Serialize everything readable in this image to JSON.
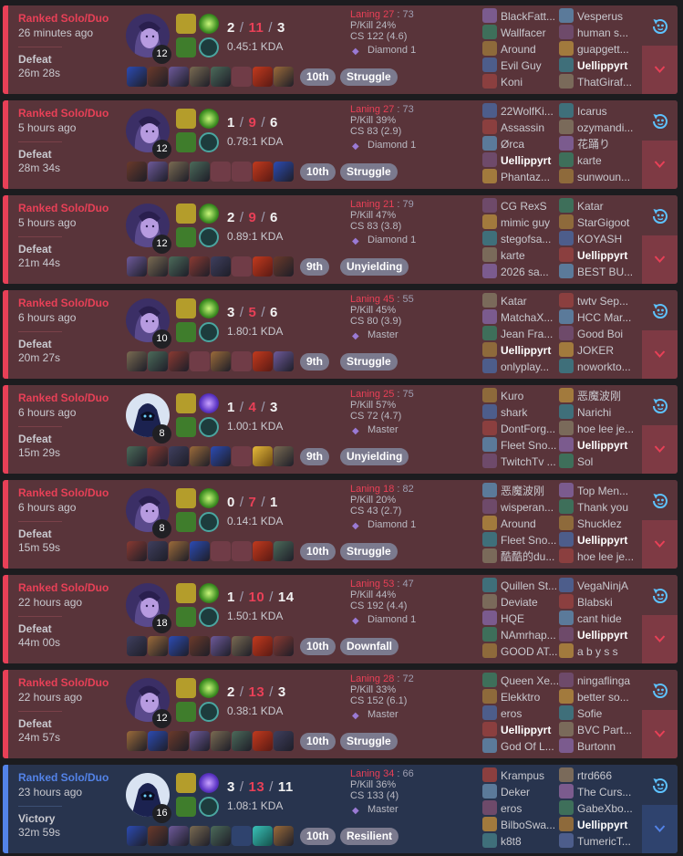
{
  "colors": {
    "loss": "#e84057",
    "win": "#5383e8",
    "badge": "#7b7a8e",
    "tier": "#9a7ad4"
  },
  "matches": [
    {
      "result_type": "loss",
      "queue": "Ranked Solo/Duo",
      "ago": "26 minutes ago",
      "result": "Defeat",
      "duration": "26m 28s",
      "champion_level": "12",
      "kills": "2",
      "deaths": "11",
      "assists": "3",
      "kda_ratio": "0.45:1 KDA",
      "laning_label": "Laning",
      "laning_self": "27",
      "laning_opp": "73",
      "kill_participation": "P/Kill 24%",
      "cs": "CS 122 (4.6)",
      "tier": "Diamond 1",
      "placement": "10th",
      "badge": "Struggle",
      "champion_icon": "dark-mage-portrait",
      "items": [
        "item",
        "item",
        "item",
        "item",
        "item",
        "empty",
        "ward",
        "item"
      ],
      "blue_team": [
        "BlackFatt...",
        "Wallfacer",
        "Around",
        "Evil Guy",
        "Koni"
      ],
      "red_team": [
        "Vesperus",
        "human s...",
        "guapgett...",
        "Uellippyrt",
        "ThatGiraf..."
      ],
      "me": "Uellippyrt"
    },
    {
      "result_type": "loss",
      "queue": "Ranked Solo/Duo",
      "ago": "5 hours ago",
      "result": "Defeat",
      "duration": "28m 34s",
      "champion_level": "12",
      "kills": "1",
      "deaths": "9",
      "assists": "6",
      "kda_ratio": "0.78:1 KDA",
      "laning_label": "Laning",
      "laning_self": "27",
      "laning_opp": "73",
      "kill_participation": "P/Kill 39%",
      "cs": "CS 83 (2.9)",
      "tier": "Diamond 1",
      "placement": "10th",
      "badge": "Struggle",
      "champion_icon": "dark-mage-portrait",
      "items": [
        "item",
        "item",
        "item",
        "item",
        "empty",
        "empty",
        "ward",
        "item"
      ],
      "blue_team": [
        "22WolfKi...",
        "Assassin",
        "Ørca",
        "Uellippyrt",
        "Phantaz..."
      ],
      "red_team": [
        "Icarus",
        "ozymandi...",
        "花踊り",
        "karte",
        "sunwoun..."
      ],
      "me": "Uellippyrt"
    },
    {
      "result_type": "loss",
      "queue": "Ranked Solo/Duo",
      "ago": "5 hours ago",
      "result": "Defeat",
      "duration": "21m 44s",
      "champion_level": "12",
      "kills": "2",
      "deaths": "9",
      "assists": "6",
      "kda_ratio": "0.89:1 KDA",
      "laning_label": "Laning",
      "laning_self": "21",
      "laning_opp": "79",
      "kill_participation": "P/Kill 47%",
      "cs": "CS 83 (3.8)",
      "tier": "Diamond 1",
      "placement": "9th",
      "badge": "Unyielding",
      "champion_icon": "dark-mage-portrait",
      "items": [
        "item",
        "item",
        "item",
        "item",
        "item",
        "empty",
        "ward",
        "item"
      ],
      "blue_team": [
        "CG RexS",
        "mimic guy",
        "stegofsa...",
        "karte",
        "2026 sa..."
      ],
      "red_team": [
        "Katar",
        "StarGigoot",
        "KOYASH",
        "Uellippyrt",
        "BEST BU..."
      ],
      "me": "Uellippyrt"
    },
    {
      "result_type": "loss",
      "queue": "Ranked Solo/Duo",
      "ago": "6 hours ago",
      "result": "Defeat",
      "duration": "20m 27s",
      "champion_level": "10",
      "kills": "3",
      "deaths": "5",
      "assists": "6",
      "kda_ratio": "1.80:1 KDA",
      "laning_label": "Laning",
      "laning_self": "45",
      "laning_opp": "55",
      "kill_participation": "P/Kill 45%",
      "cs": "CS 80 (3.9)",
      "tier": "Master",
      "placement": "9th",
      "badge": "Struggle",
      "champion_icon": "dark-mage-portrait",
      "items": [
        "item",
        "item",
        "item",
        "empty",
        "item",
        "empty",
        "ward",
        "item"
      ],
      "blue_team": [
        "Katar",
        "MatchaX...",
        "Jean Fra...",
        "Uellippyrt",
        "onlyplay..."
      ],
      "red_team": [
        "twtv Sep...",
        "HCC Mar...",
        "Good Boi",
        "JOKER",
        "noworkto..."
      ],
      "me": "Uellippyrt"
    },
    {
      "result_type": "loss",
      "queue": "Ranked Solo/Duo",
      "ago": "6 hours ago",
      "result": "Defeat",
      "duration": "15m 29s",
      "champion_level": "8",
      "kills": "1",
      "deaths": "4",
      "assists": "3",
      "kda_ratio": "1.00:1 KDA",
      "laning_label": "Laning",
      "laning_self": "25",
      "laning_opp": "75",
      "kill_participation": "P/Kill 57%",
      "cs": "CS 72 (4.7)",
      "tier": "Master",
      "placement": "9th",
      "badge": "Unyielding",
      "champion_icon": "hooded-knight-portrait",
      "items": [
        "item",
        "item",
        "item",
        "item",
        "item",
        "empty",
        "ward-gold",
        "item"
      ],
      "blue_team": [
        "Kuro",
        "shark",
        "DontForg...",
        "Fleet Sno...",
        "TwitchTv ..."
      ],
      "red_team": [
        "恶魔波刚",
        "Narichi",
        "hoe lee je...",
        "Uellippyrt",
        "Sol"
      ],
      "me": "Uellippyrt"
    },
    {
      "result_type": "loss",
      "queue": "Ranked Solo/Duo",
      "ago": "6 hours ago",
      "result": "Defeat",
      "duration": "15m 59s",
      "champion_level": "8",
      "kills": "0",
      "deaths": "7",
      "assists": "1",
      "kda_ratio": "0.14:1 KDA",
      "laning_label": "Laning",
      "laning_self": "18",
      "laning_opp": "82",
      "kill_participation": "P/Kill 20%",
      "cs": "CS 43 (2.7)",
      "tier": "Diamond 1",
      "placement": "10th",
      "badge": "Struggle",
      "champion_icon": "dark-mage-portrait",
      "items": [
        "item",
        "item",
        "item",
        "item",
        "empty",
        "empty",
        "ward",
        "item"
      ],
      "blue_team": [
        "恶魔波刚",
        "wisperan...",
        "Around",
        "Fleet Sno...",
        "酷酷的du..."
      ],
      "red_team": [
        "Top Men...",
        "Thank you",
        "Shucklez",
        "Uellippyrt",
        "hoe lee je..."
      ],
      "me": "Uellippyrt"
    },
    {
      "result_type": "loss",
      "queue": "Ranked Solo/Duo",
      "ago": "22 hours ago",
      "result": "Defeat",
      "duration": "44m 00s",
      "champion_level": "18",
      "kills": "1",
      "deaths": "10",
      "assists": "14",
      "kda_ratio": "1.50:1 KDA",
      "laning_label": "Laning",
      "laning_self": "53",
      "laning_opp": "47",
      "kill_participation": "P/Kill 44%",
      "cs": "CS 192 (4.4)",
      "tier": "Diamond 1",
      "placement": "10th",
      "badge": "Downfall",
      "champion_icon": "dark-mage-portrait",
      "items": [
        "item",
        "item",
        "item",
        "item",
        "item",
        "item",
        "ward",
        "item"
      ],
      "blue_team": [
        "Quillen St...",
        "Deviate",
        "HQE",
        "NAmrhap...",
        "GOOD AT..."
      ],
      "red_team": [
        "VegaNinjA",
        "Blabski",
        "cant hide",
        "Uellippyrt",
        "a b y s s"
      ],
      "me": "Uellippyrt"
    },
    {
      "result_type": "loss",
      "queue": "Ranked Solo/Duo",
      "ago": "22 hours ago",
      "result": "Defeat",
      "duration": "24m 57s",
      "champion_level": "12",
      "kills": "2",
      "deaths": "13",
      "assists": "3",
      "kda_ratio": "0.38:1 KDA",
      "laning_label": "Laning",
      "laning_self": "28",
      "laning_opp": "72",
      "kill_participation": "P/Kill 33%",
      "cs": "CS 152 (6.1)",
      "tier": "Master",
      "placement": "10th",
      "badge": "Struggle",
      "champion_icon": "dark-mage-portrait",
      "items": [
        "item",
        "item",
        "item",
        "item",
        "item",
        "item",
        "ward",
        "item"
      ],
      "blue_team": [
        "Queen Xe...",
        "Elekktro",
        "eros",
        "Uellippyrt",
        "God Of L..."
      ],
      "red_team": [
        "ningaflinga",
        "better so...",
        "Sofie",
        "BVC Part...",
        "Burtonn"
      ],
      "me": "Uellippyrt"
    },
    {
      "result_type": "win",
      "queue": "Ranked Solo/Duo",
      "ago": "23 hours ago",
      "result": "Victory",
      "duration": "32m 59s",
      "champion_level": "16",
      "kills": "3",
      "deaths": "13",
      "assists": "11",
      "kda_ratio": "1.08:1 KDA",
      "laning_label": "Laning",
      "laning_self": "34",
      "laning_opp": "66",
      "kill_participation": "P/Kill 36%",
      "cs": "CS 133 (4)",
      "tier": "Master",
      "placement": "10th",
      "badge": "Resilient",
      "champion_icon": "hooded-knight-portrait",
      "items": [
        "item",
        "item",
        "item",
        "item",
        "item",
        "empty",
        "ward-teal",
        "item"
      ],
      "blue_team": [
        "Krampus",
        "Deker",
        "eros",
        "BilboSwa...",
        "k8t8"
      ],
      "red_team": [
        "rtrd666",
        "The Curs...",
        "GabeXbo...",
        "Uellippyrt",
        "TumericT..."
      ],
      "me": "Uellippyrt"
    }
  ]
}
